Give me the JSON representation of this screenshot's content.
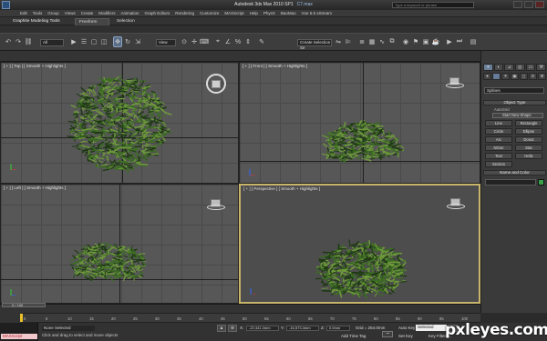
{
  "window": {
    "title": "Autodesk 3ds Max 2010 SP1",
    "file": "C7.max",
    "search_placeholder": "Type a keyword or phrase"
  },
  "menu": [
    "Edit",
    "Tools",
    "Group",
    "Views",
    "Create",
    "Modifiers",
    "Animation",
    "Graph Editors",
    "Rendering",
    "Customize",
    "MAXScript",
    "Help",
    "PhysX",
    "BaoMao",
    "Vue 6.5 xStream"
  ],
  "ribbon": {
    "label": "Graphite Modeling Tools",
    "tabs": [
      "Freeform",
      "Selection"
    ]
  },
  "toolbar": {
    "filter_value": "All",
    "view_value": "View",
    "named_selection_value": "Create Selection Se"
  },
  "viewports": {
    "top": "[ + ] [ Top ] [ Smooth + Highlights ]",
    "front": "[ + ] [ Front ] [ Smooth + Highlights ]",
    "left": "[ + ] [ Left ] [ Smooth + Highlights ]",
    "perspective": "[ + ] [ Perspective ] [ Smooth + Highlights ]"
  },
  "command_panel": {
    "category_value": "Splines",
    "object_type_header": "Object Type",
    "autogrid_label": "AutoGrid",
    "start_new_shape_label": "Start New Shape",
    "buttons": [
      "Line",
      "Rectangle",
      "Circle",
      "Ellipse",
      "Arc",
      "Donut",
      "NGon",
      "Star",
      "Text",
      "Helix",
      "Section"
    ],
    "name_color_header": "Name and Color"
  },
  "timeline": {
    "frame_readout": "0 / 100",
    "ticks": [
      "0",
      "5",
      "10",
      "15",
      "20",
      "25",
      "30",
      "35",
      "40",
      "45",
      "50",
      "55",
      "60",
      "65",
      "70",
      "75",
      "80",
      "85",
      "90",
      "95",
      "100"
    ]
  },
  "status": {
    "maxscript_label": "MAXScript",
    "selection_text": "None Selected",
    "prompt_text": "Click and drag to select and move objects",
    "x_label": "X:",
    "x_value": "-22,441.4mm",
    "y_label": "Y:",
    "y_value": "-16,573.4mm",
    "z_label": "Z:",
    "z_value": "0.0mm",
    "grid_text": "Grid = 254.0mm",
    "add_time_tag": "Add Time Tag",
    "auto_key": "Auto Key",
    "set_key": "Set Key",
    "key_filters": "Key Filters...",
    "selected_value": "Selected"
  },
  "watermark": "pxleyes.com",
  "colors": {
    "plant_dark": "#1f3a14",
    "plant_mid": "#3c6e22",
    "plant_light": "#6f9a3c",
    "active_viewport_border": "#c8b46a",
    "color_swatch": "#3aa04a"
  }
}
